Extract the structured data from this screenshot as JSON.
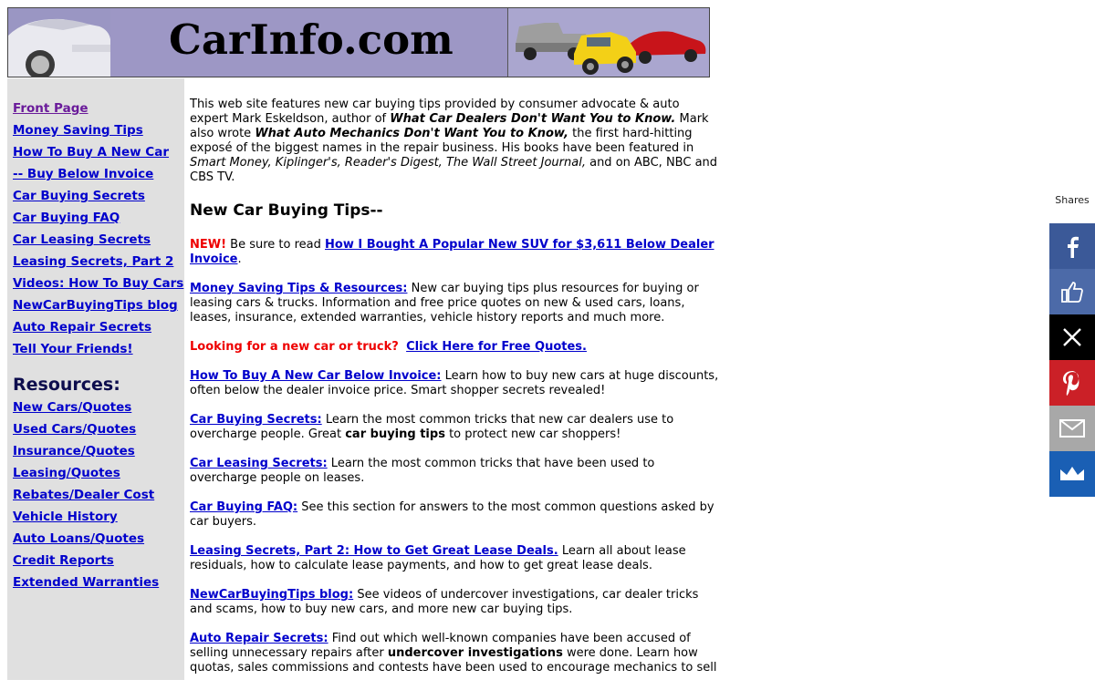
{
  "banner": {
    "title": "CarInfo.com"
  },
  "sidebar": {
    "nav": [
      {
        "label": "Front Page",
        "visited": true
      },
      {
        "label": "Money Saving Tips"
      },
      {
        "label": "How To Buy A New Car"
      },
      {
        "label": "-- Buy Below Invoice"
      },
      {
        "label": "Car Buying Secrets"
      },
      {
        "label": "Car Buying FAQ"
      },
      {
        "label": "Car Leasing Secrets"
      },
      {
        "label": "Leasing Secrets, Part 2"
      },
      {
        "label": "Videos: How To Buy Cars"
      },
      {
        "label": "NewCarBuyingTips blog"
      },
      {
        "label": "Auto Repair Secrets"
      },
      {
        "label": "Tell Your Friends!"
      }
    ],
    "resources_heading": "Resources:",
    "resources": [
      {
        "label": "New Cars/Quotes"
      },
      {
        "label": "Used Cars/Quotes"
      },
      {
        "label": "Insurance/Quotes"
      },
      {
        "label": "Leasing/Quotes"
      },
      {
        "label": "Rebates/Dealer Cost"
      },
      {
        "label": "Vehicle History"
      },
      {
        "label": "Auto Loans/Quotes"
      },
      {
        "label": "Credit Reports"
      },
      {
        "label": "Extended Warranties"
      }
    ]
  },
  "main": {
    "intro": {
      "t1": "This web site features new car buying tips provided by consumer advocate & auto expert Mark Eskeldson, author of ",
      "b1": "What Car Dealers Don't Want You to Know.",
      "t2": " Mark also wrote ",
      "b2": "What Auto Mechanics Don't Want You to Know,",
      "t3": " the first hard-hitting exposé of the biggest names in the repair business. His books have been featured in ",
      "i1": "Smart Money, Kiplinger's, Reader's Digest, The Wall Street Journal,",
      "t4": " and on ABC, NBC and CBS TV."
    },
    "heading": "New Car Buying Tips--",
    "new_item": {
      "badge": "NEW!",
      "text": " Be sure to read ",
      "link": "How I Bought A Popular New SUV for $3,611 Below Dealer Invoice",
      "end": "."
    },
    "money": {
      "link": "Money Saving Tips & Resources:",
      "text": " New car buying tips plus resources for buying or leasing cars & trucks. Information and free price quotes on new & used cars, loans, leases, insurance, extended warranties, vehicle history reports and much more."
    },
    "looking": {
      "text": "Looking for a new car or truck?",
      "link": "Click Here for Free Quotes."
    },
    "howto": {
      "link": "How To Buy A New Car Below Invoice:",
      "text": " Learn how to buy new cars at huge discounts, often below the dealer invoice price. Smart shopper secrets revealed!"
    },
    "secrets": {
      "link": "Car Buying Secrets:",
      "t1": " Learn the most common tricks that new car dealers use to overcharge people. Great ",
      "b": "car buying tips",
      "t2": " to protect new car shoppers!"
    },
    "leasing": {
      "link": "Car Leasing Secrets:",
      "text": " Learn the most common tricks that have been used to overcharge people on leases."
    },
    "faq": {
      "link": "Car Buying FAQ:",
      "text": " See this section for answers to the most common questions asked by car buyers."
    },
    "leasing2": {
      "link": "Leasing Secrets, Part 2: How to Get Great Lease Deals.",
      "text": " Learn all about lease residuals, how to calculate lease payments, and how to get great lease deals."
    },
    "blog": {
      "link": "NewCarBuyingTips blog:",
      "text": " See videos of undercover investigations, car dealer tricks and scams, how to buy new cars, and more new car buying tips."
    },
    "repair": {
      "link": "Auto Repair Secrets:",
      "t1": " Find out which well-known companies have been accused of selling unnecessary repairs after ",
      "b": "undercover investigations",
      "t2": " were done. Learn how quotas, sales commissions and contests have been used to encourage mechanics to sell"
    }
  },
  "share": {
    "label": "Shares",
    "buttons": [
      {
        "name": "facebook",
        "color": "#3b5998",
        "glyph": "f"
      },
      {
        "name": "like",
        "color": "#4c6aa8",
        "glyph": "👍"
      },
      {
        "name": "x",
        "color": "#000000",
        "glyph": "𝕏"
      },
      {
        "name": "pinterest",
        "color": "#cb2027",
        "glyph": "P"
      },
      {
        "name": "email",
        "color": "#a8a8a8",
        "glyph": "✉"
      },
      {
        "name": "sumo",
        "color": "#1a5fb4",
        "glyph": "♛"
      }
    ]
  }
}
